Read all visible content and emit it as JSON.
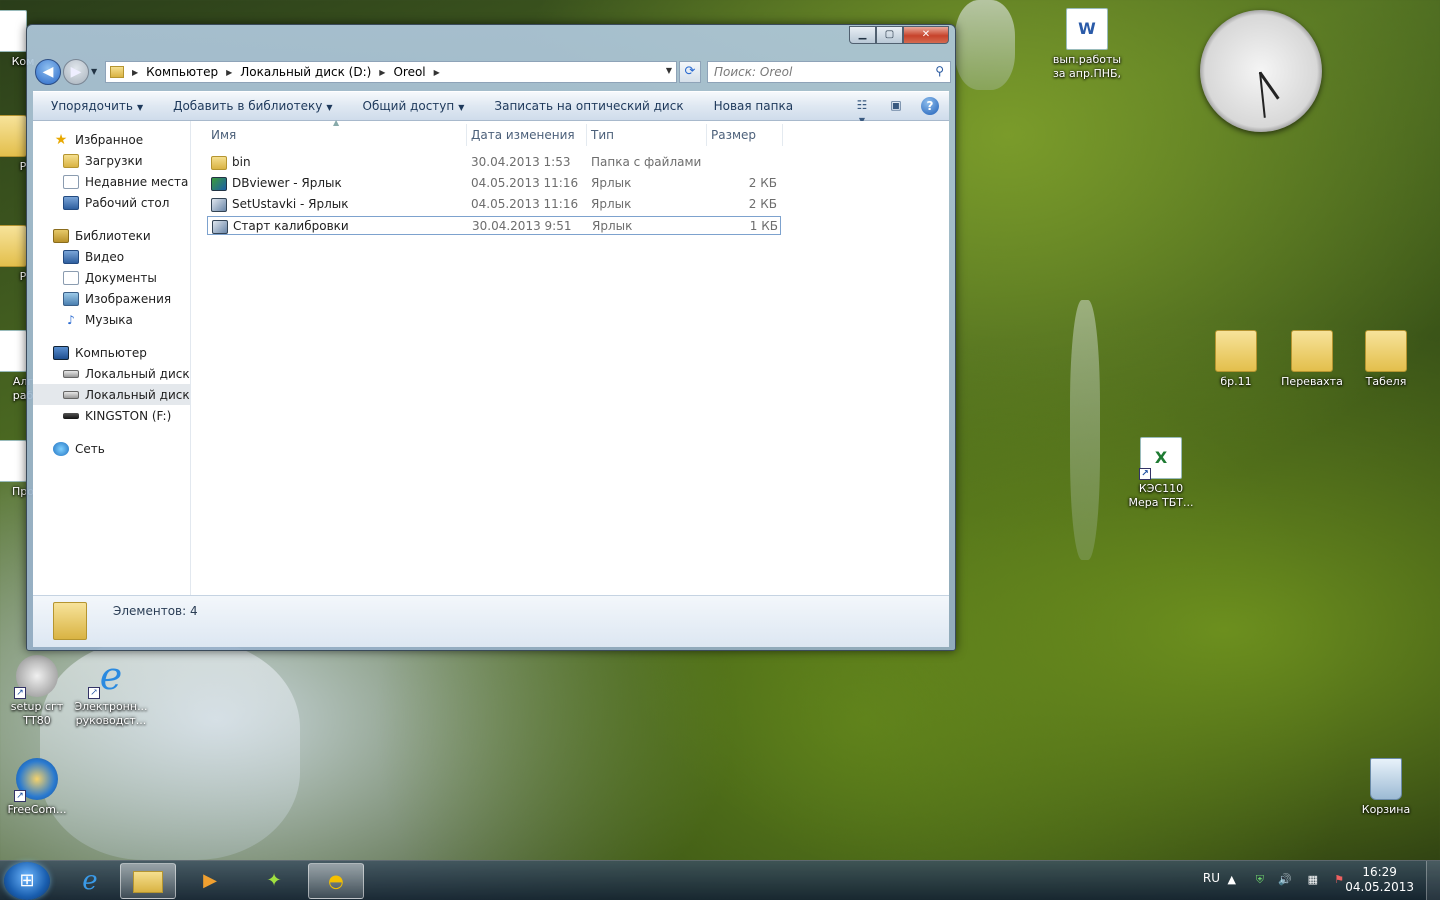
{
  "desktop": {
    "icons_left": [
      {
        "label": "Ком"
      },
      {
        "label": "Р"
      },
      {
        "label": "Р"
      },
      {
        "label": "Алг\nраб"
      },
      {
        "label": "Про"
      }
    ],
    "icons_bottom_left": [
      {
        "label": "setup сгт\nТТ80"
      },
      {
        "label": "Электронн...\nруководст..."
      },
      {
        "label": "FreeCom..."
      }
    ],
    "icons_right": [
      {
        "label": "вып.работы\nза апр.ПНБ,"
      },
      {
        "label": "бр.11"
      },
      {
        "label": "Перевахта"
      },
      {
        "label": "Табеля"
      },
      {
        "label": "КЭС110\nМера ТБТ..."
      },
      {
        "label": "Корзина"
      }
    ]
  },
  "window": {
    "address": {
      "segments": [
        "Компьютер",
        "Локальный диск (D:)",
        "Oreol"
      ]
    },
    "search_placeholder": "Поиск: Oreol",
    "toolbar": {
      "organize": "Упорядочить",
      "add_library": "Добавить в библиотеку",
      "share": "Общий доступ",
      "burn": "Записать на оптический диск",
      "new_folder": "Новая папка"
    },
    "nav": {
      "favorites": "Избранное",
      "downloads": "Загрузки",
      "recent": "Недавние места",
      "desktop": "Рабочий стол",
      "libraries": "Библиотеки",
      "video": "Видео",
      "documents": "Документы",
      "images": "Изображения",
      "music": "Музыка",
      "computer": "Компьютер",
      "drive_c": "Локальный диск (C",
      "drive_d": "Локальный диск (D",
      "kingston": "KINGSTON (F:)",
      "network": "Сеть"
    },
    "columns": {
      "name": "Имя",
      "date": "Дата изменения",
      "type": "Тип",
      "size": "Размер"
    },
    "files": [
      {
        "name": "bin",
        "date": "30.04.2013 1:53",
        "type": "Папка с файлами",
        "size": ""
      },
      {
        "name": "DBviewer - Ярлык",
        "date": "04.05.2013 11:16",
        "type": "Ярлык",
        "size": "2 КБ"
      },
      {
        "name": "SetUstavki - Ярлык",
        "date": "04.05.2013 11:16",
        "type": "Ярлык",
        "size": "2 КБ"
      },
      {
        "name": "Старт калибровки",
        "date": "30.04.2013 9:51",
        "type": "Ярлык",
        "size": "1 КБ"
      }
    ],
    "status": "Элементов: 4"
  },
  "taskbar": {
    "lang": "RU",
    "time": "16:29",
    "date": "04.05.2013"
  },
  "colors": {
    "accent": "#1e395b",
    "selection_border": "#7da2ce"
  }
}
